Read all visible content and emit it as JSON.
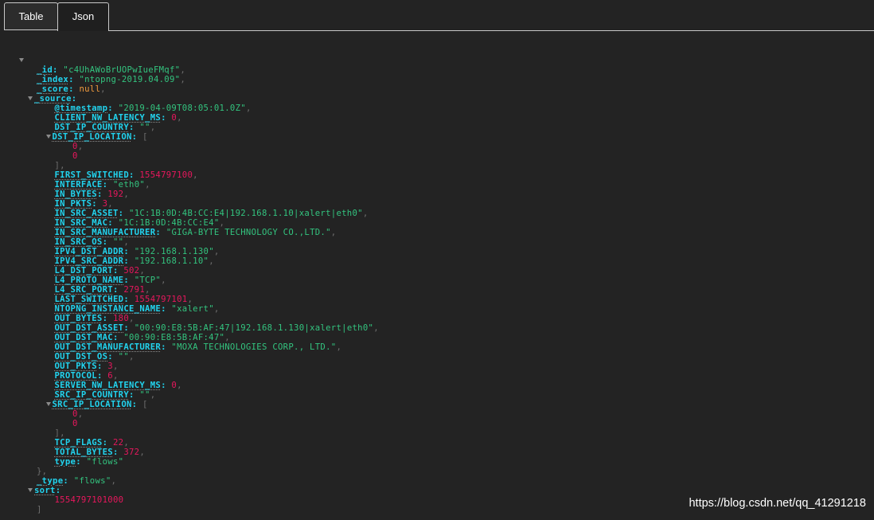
{
  "tabs": [
    {
      "label": "Table",
      "active": false
    },
    {
      "label": "Json",
      "active": true
    }
  ],
  "document": {
    "_id": "c4UhAWoBrUOPwIueFMqf",
    "_index": "ntopng-2019.04.09",
    "_score": "null",
    "_source": {
      "@timestamp": "2019-04-09T08:05:01.0Z",
      "CLIENT_NW_LATENCY_MS": "0",
      "DST_IP_COUNTRY": "",
      "DST_IP_LOCATION": [
        "0",
        "0"
      ],
      "FIRST_SWITCHED": "1554797100",
      "INTERFACE": "eth0",
      "IN_BYTES": "192",
      "IN_PKTS": "3",
      "IN_SRC_ASSET": "1C:1B:0D:4B:CC:E4|192.168.1.10|xalert|eth0",
      "IN_SRC_MAC": "1C:1B:0D:4B:CC:E4",
      "IN_SRC_MANUFACTURER": "GIGA-BYTE TECHNOLOGY CO.,LTD.",
      "IN_SRC_OS": "",
      "IPV4_DST_ADDR": "192.168.1.130",
      "IPV4_SRC_ADDR": "192.168.1.10",
      "L4_DST_PORT": "502",
      "L4_PROTO_NAME": "TCP",
      "L4_SRC_PORT": "2791",
      "LAST_SWITCHED": "1554797101",
      "NTOPNG_INSTANCE_NAME": "xalert",
      "OUT_BYTES": "180",
      "OUT_DST_ASSET": "00:90:E8:5B:AF:47|192.168.1.130|xalert|eth0",
      "OUT_DST_MAC": "00:90:E8:5B:AF:47",
      "OUT_DST_MANUFACTURER": "MOXA TECHNOLOGIES CORP., LTD.",
      "OUT_DST_OS": "",
      "OUT_PKTS": "3",
      "PROTOCOL": "6",
      "SERVER_NW_LATENCY_MS": "0",
      "SRC_IP_COUNTRY": "",
      "SRC_IP_LOCATION": [
        "0",
        "0"
      ],
      "TCP_FLAGS": "22",
      "TOTAL_BYTES": "372",
      "type": "flows"
    },
    "_type": "flows",
    "sort": [
      "1554797101000"
    ]
  },
  "watermark": "https://blog.csdn.net/qq_41291218",
  "icons": {
    "toggle": "caret-down-icon"
  },
  "colors": {
    "background": "#232323",
    "key": "#22d3ee",
    "string": "#33c47f",
    "number": "#e8175d",
    "null": "#f29b3d",
    "punctuation": "#6e6e6e",
    "tab_border": "#c9c9c9"
  }
}
